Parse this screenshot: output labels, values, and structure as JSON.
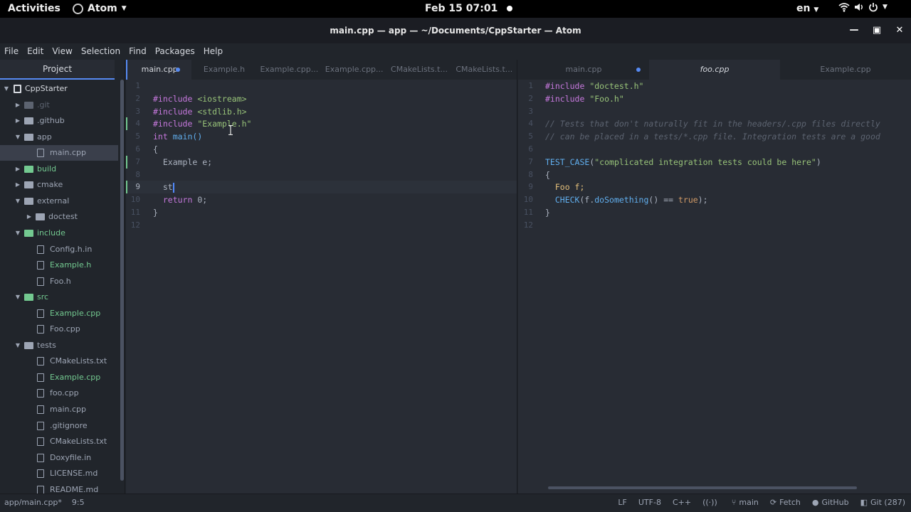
{
  "topbar": {
    "activities": "Activities",
    "app_menu": "Atom",
    "clock": "Feb 15  07:01",
    "language": "en"
  },
  "window": {
    "title": "main.cpp — app — ~/Documents/CppStarter — Atom"
  },
  "menu": [
    "File",
    "Edit",
    "View",
    "Selection",
    "Find",
    "Packages",
    "Help"
  ],
  "tree": {
    "header": "Project",
    "items": [
      {
        "label": "CppStarter",
        "kind": "repo",
        "level": 0,
        "expanded": true,
        "style": "root"
      },
      {
        "label": ".git",
        "kind": "folder",
        "level": 1,
        "expanded": false,
        "style": "dim"
      },
      {
        "label": ".github",
        "kind": "folder",
        "level": 1,
        "expanded": false,
        "style": "normal"
      },
      {
        "label": "app",
        "kind": "folder",
        "level": 1,
        "expanded": true,
        "style": "normal"
      },
      {
        "label": "main.cpp",
        "kind": "file",
        "level": 2,
        "style": "normal",
        "selected": true
      },
      {
        "label": "build",
        "kind": "folder",
        "level": 1,
        "expanded": false,
        "style": "green"
      },
      {
        "label": "cmake",
        "kind": "folder",
        "level": 1,
        "expanded": false,
        "style": "normal"
      },
      {
        "label": "external",
        "kind": "folder",
        "level": 1,
        "expanded": true,
        "style": "normal"
      },
      {
        "label": "doctest",
        "kind": "folder",
        "level": 2,
        "expanded": false,
        "style": "normal"
      },
      {
        "label": "include",
        "kind": "folder",
        "level": 1,
        "expanded": true,
        "style": "green"
      },
      {
        "label": "Config.h.in",
        "kind": "file",
        "level": 2,
        "style": "normal"
      },
      {
        "label": "Example.h",
        "kind": "file",
        "level": 2,
        "style": "green"
      },
      {
        "label": "Foo.h",
        "kind": "file",
        "level": 2,
        "style": "normal"
      },
      {
        "label": "src",
        "kind": "folder",
        "level": 1,
        "expanded": true,
        "style": "green"
      },
      {
        "label": "Example.cpp",
        "kind": "file",
        "level": 2,
        "style": "green"
      },
      {
        "label": "Foo.cpp",
        "kind": "file",
        "level": 2,
        "style": "normal"
      },
      {
        "label": "tests",
        "kind": "folder",
        "level": 1,
        "expanded": true,
        "style": "normal"
      },
      {
        "label": "CMakeLists.txt",
        "kind": "file",
        "level": 2,
        "style": "normal"
      },
      {
        "label": "Example.cpp",
        "kind": "file",
        "level": 2,
        "style": "green"
      },
      {
        "label": "foo.cpp",
        "kind": "file",
        "level": 2,
        "style": "normal"
      },
      {
        "label": "main.cpp",
        "kind": "file",
        "level": 2,
        "style": "normal"
      },
      {
        "label": ".gitignore",
        "kind": "file",
        "level": 1,
        "style": "normal"
      },
      {
        "label": "CMakeLists.txt",
        "kind": "file",
        "level": 1,
        "style": "normal"
      },
      {
        "label": "Doxyfile.in",
        "kind": "file",
        "level": 1,
        "style": "normal"
      },
      {
        "label": "LICENSE.md",
        "kind": "file",
        "level": 1,
        "style": "normal"
      },
      {
        "label": "README.md",
        "kind": "file",
        "level": 1,
        "style": "normal"
      }
    ]
  },
  "left_pane": {
    "tabs": [
      {
        "label": "main.cpp",
        "active": true,
        "modified": true
      },
      {
        "label": "Example.h",
        "active": false
      },
      {
        "label": "Example.cpp...",
        "active": false
      },
      {
        "label": "Example.cpp...",
        "active": false
      },
      {
        "label": "CMakeLists.t...",
        "active": false
      },
      {
        "label": "CMakeLists.t...",
        "active": false
      }
    ],
    "cursor_line": 9,
    "lines": [
      [],
      [
        [
          "#include ",
          "k"
        ],
        [
          "<iostream>",
          "s"
        ]
      ],
      [
        [
          "#include ",
          "k"
        ],
        [
          "<stdlib.h>",
          "s"
        ]
      ],
      [
        [
          "#include ",
          "k"
        ],
        [
          "\"Example.h\"",
          "s"
        ]
      ],
      [
        [
          "int",
          "k"
        ],
        [
          " main()",
          "f"
        ]
      ],
      [
        [
          "{",
          ""
        ]
      ],
      [
        [
          "  Example e;",
          ""
        ]
      ],
      [],
      [
        [
          "  st",
          ""
        ]
      ],
      [
        [
          "  ",
          ""
        ],
        [
          "return",
          "k"
        ],
        [
          " 0;",
          ""
        ]
      ],
      [
        [
          "}",
          ""
        ]
      ],
      []
    ],
    "git_modified_lines": [
      4,
      7,
      9
    ]
  },
  "right_pane": {
    "tabs": [
      {
        "label": "main.cpp",
        "active": false,
        "modified": true
      },
      {
        "label": "foo.cpp",
        "active": true,
        "italic": true
      },
      {
        "label": "Example.cpp",
        "active": false
      }
    ],
    "lines": [
      [
        [
          "#include ",
          "k"
        ],
        [
          "\"doctest.h\"",
          "s"
        ]
      ],
      [
        [
          "#include ",
          "k"
        ],
        [
          "\"Foo.h\"",
          "s"
        ]
      ],
      [],
      [
        [
          "// Tests that don't naturally fit in the headers/.cpp files directly",
          "c"
        ]
      ],
      [
        [
          "// can be placed in a tests/*.cpp file. Integration tests are a good",
          "c"
        ]
      ],
      [],
      [
        [
          "TEST_CASE",
          "f"
        ],
        [
          "(",
          ""
        ],
        [
          "\"complicated integration tests could be here\"",
          "s"
        ],
        [
          ")",
          ""
        ]
      ],
      [
        [
          "{",
          ""
        ]
      ],
      [
        [
          "  Foo f;",
          "t"
        ]
      ],
      [
        [
          "  CHECK",
          "f"
        ],
        [
          "(f.",
          ""
        ],
        [
          "doSomething",
          "f"
        ],
        [
          "() == ",
          ""
        ],
        [
          "true",
          "b"
        ],
        [
          ");",
          ""
        ]
      ],
      [
        [
          "}",
          ""
        ]
      ],
      []
    ]
  },
  "statusbar": {
    "file": "app/main.cpp*",
    "position": "9:5",
    "line_ending": "LF",
    "encoding": "UTF-8",
    "grammar": "C++",
    "branch": "main",
    "fetch": "Fetch",
    "github": "GitHub",
    "git": "Git (287)"
  }
}
